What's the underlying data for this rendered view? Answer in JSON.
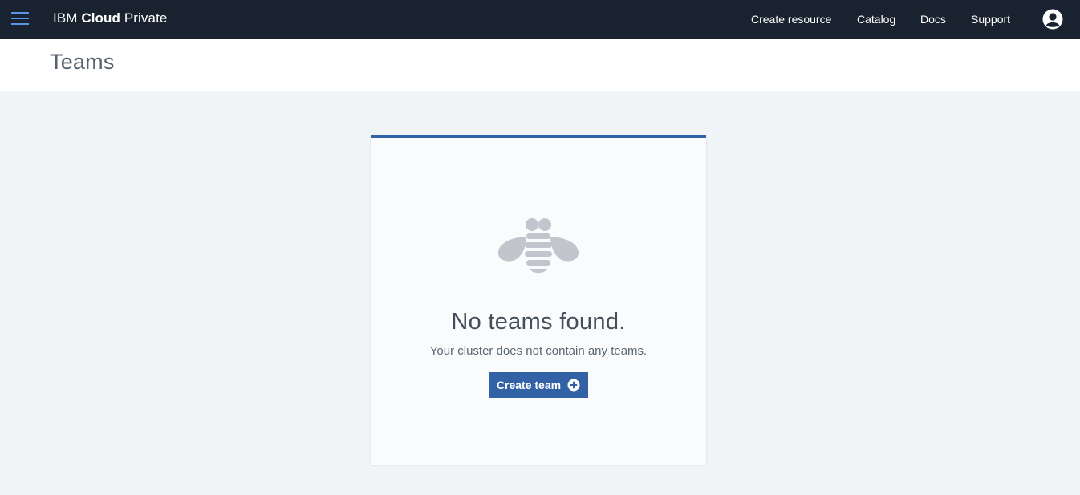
{
  "app": {
    "brand_prefix": "IBM",
    "brand_bold": "Cloud",
    "brand_suffix": "Private"
  },
  "nav": {
    "items": [
      {
        "label": "Create resource"
      },
      {
        "label": "Catalog"
      },
      {
        "label": "Docs"
      },
      {
        "label": "Support"
      }
    ],
    "menu_icon": "hamburger-menu-icon",
    "user_icon": "user-avatar-icon"
  },
  "page": {
    "title": "Teams"
  },
  "empty_state": {
    "icon": "bee-icon",
    "title": "No teams found.",
    "message": "Your cluster does not contain any teams.",
    "button_label": "Create team",
    "button_icon": "add-circle-icon"
  },
  "colors": {
    "topbar": "#18232f",
    "accent": "#3361a5",
    "menu_icon": "#5a94e8",
    "background": "#f1f4f7"
  }
}
